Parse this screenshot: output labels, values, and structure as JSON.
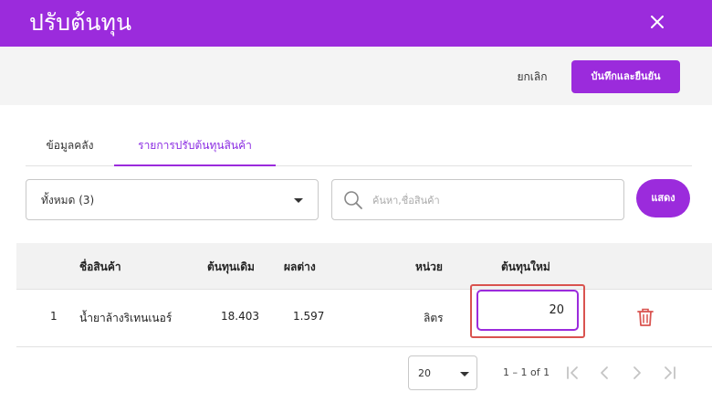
{
  "header": {
    "title": "ปรับต้นทุน"
  },
  "toolbar": {
    "cancel_label": "ยกเลิก",
    "save_label": "บันทึกและยืนยัน"
  },
  "tabs": [
    {
      "label": "ข้อมูลคลัง",
      "active": false
    },
    {
      "label": "รายการปรับต้นทุนสินค้า",
      "active": true
    }
  ],
  "filter": {
    "selected": "ทั้งหมด (3)",
    "search_placeholder": "ค้นหา,ชื่อสินค้า",
    "show_label": "แสดง"
  },
  "table": {
    "columns": [
      "",
      "ชื่อสินค้า",
      "ต้นทุนเดิม",
      "ผลต่าง",
      "หน่วย",
      "ต้นทุนใหม่"
    ],
    "rows": [
      {
        "no": "1",
        "name": "น้ำยาล้างริเทนเนอร์",
        "old_cost": "18.403",
        "diff": "1.597",
        "unit": "ลิตร",
        "new_cost": "20"
      }
    ]
  },
  "pagination": {
    "per_page": "20",
    "range": "1 – 1 of 1"
  },
  "colors": {
    "accent": "#9b2bdc",
    "danger": "#d9534f"
  },
  "icons": [
    "close-icon",
    "search-icon",
    "trash-icon",
    "first-page-icon",
    "prev-page-icon",
    "next-page-icon",
    "last-page-icon"
  ]
}
